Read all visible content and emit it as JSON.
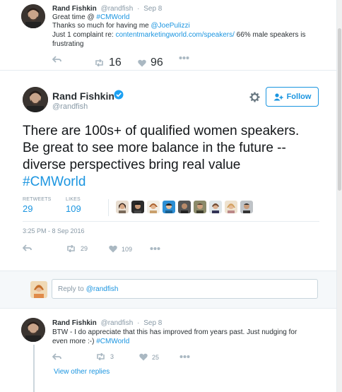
{
  "tweet_top": {
    "name": "Rand Fishkin",
    "handle": "@randfish",
    "separator": "·",
    "date": "Sep 8",
    "line1_prefix": "Great time @ ",
    "line1_hashtag": "#CMWorld",
    "line2_prefix": "Thanks so much for having me ",
    "line2_mention": "@JoePulizzi",
    "line3_prefix": "Just 1 complaint re: ",
    "line3_link": "contentmarketingworld.com/speakers/",
    "line3_suffix": " 66% male speakers is",
    "line4": "frustrating",
    "retweets": "16",
    "likes": "96",
    "icons": [
      "reply-icon",
      "retweet-icon",
      "heart-icon",
      "more-icon"
    ]
  },
  "tweet_main": {
    "name": "Rand Fishkin",
    "handle": "@randfish",
    "follow_label": "Follow",
    "text_line1": "There are 100s+ of qualified women speakers.",
    "text_line2": "Be great to see more balance in the future --",
    "text_line3": "diverse perspectives bring real value",
    "hashtag": "#CMWorld",
    "retweets_label": "RETWEETS",
    "retweets_value": "29",
    "likes_label": "LIKES",
    "likes_value": "109",
    "timestamp": "3:25 PM - 8 Sep 2016",
    "action_retweets": "29",
    "action_likes": "109",
    "likers_count": 9,
    "colors": {
      "accent": "#1b95e0",
      "verified": "#1da1f2"
    },
    "icons": [
      "verified-icon",
      "gear-icon",
      "follow-icon",
      "reply-icon",
      "retweet-icon",
      "heart-icon",
      "more-icon"
    ]
  },
  "reply": {
    "placeholder": "Reply to",
    "mention": "@randfish"
  },
  "tweet_bottom": {
    "name": "Rand Fishkin",
    "handle": "@randfish",
    "separator": "·",
    "date": "Sep 8",
    "line1": "BTW - I do appreciate that this has improved from years past. Just nudging for",
    "line2_prefix": "even more :-) ",
    "line2_hashtag": "#CMWorld",
    "retweets": "3",
    "likes": "25",
    "view_other_replies": "View other replies"
  }
}
